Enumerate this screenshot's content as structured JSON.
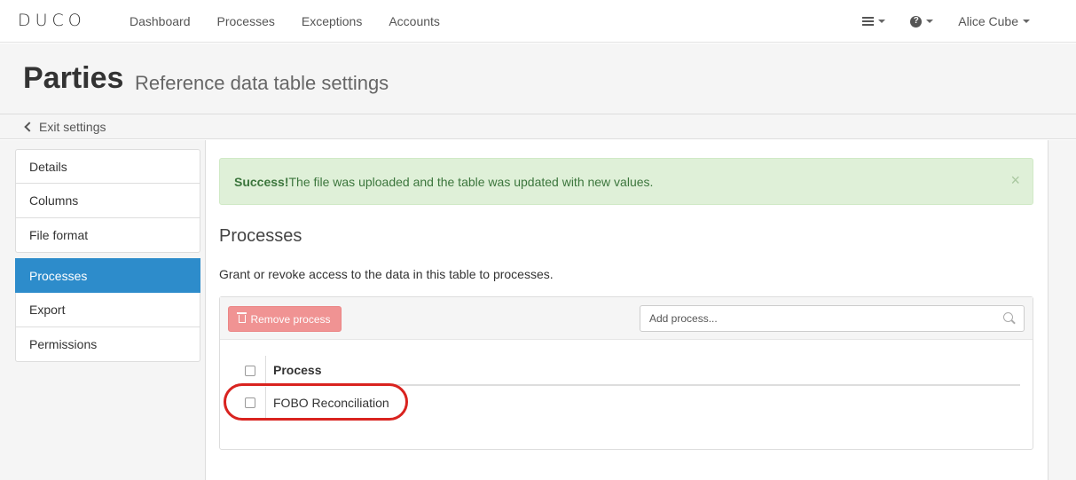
{
  "brand": {
    "logo_text": "DUCO"
  },
  "nav": {
    "links": [
      "Dashboard",
      "Processes",
      "Exceptions",
      "Accounts"
    ],
    "user": "Alice Cube"
  },
  "header": {
    "title": "Parties",
    "subtitle": "Reference data table settings"
  },
  "exit": {
    "label": "Exit settings"
  },
  "sidebar": {
    "items": [
      {
        "label": "Details",
        "active": false
      },
      {
        "label": "Columns",
        "active": false
      },
      {
        "label": "File format",
        "active": false
      },
      {
        "label": "Processes",
        "active": true
      },
      {
        "label": "Export",
        "active": false
      },
      {
        "label": "Permissions",
        "active": false
      }
    ]
  },
  "alert": {
    "strong": "Success!",
    "message": "The file was uploaded and the table was updated with new values.",
    "close": "×"
  },
  "section": {
    "title": "Processes",
    "description": "Grant or revoke access to the data in this table to processes."
  },
  "toolbar": {
    "remove_label": "Remove process",
    "add_placeholder": "Add process..."
  },
  "table": {
    "header": "Process",
    "rows": [
      "FOBO Reconciliation"
    ]
  },
  "colors": {
    "accent": "#2d8ccb",
    "success_bg": "#dff0d8",
    "danger": "#f08e8e",
    "highlight": "#d9231f"
  }
}
